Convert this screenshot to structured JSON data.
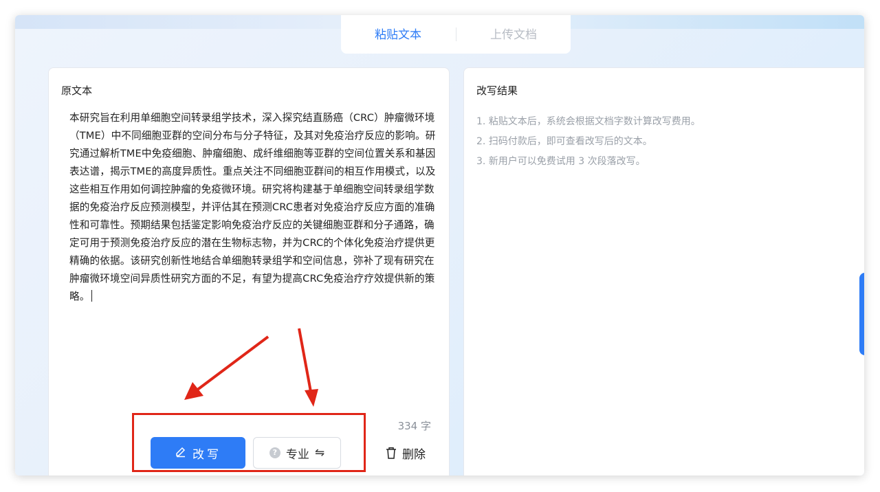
{
  "tabs": {
    "paste": "粘贴文本",
    "upload": "上传文档"
  },
  "source_panel": {
    "title": "原文本",
    "text": "本研究旨在利用单细胞空间转录组学技术，深入探究结直肠癌（CRC）肿瘤微环境（TME）中不同细胞亚群的空间分布与分子特征，及其对免疫治疗反应的影响。研究通过解析TME中免疫细胞、肿瘤细胞、成纤维细胞等亚群的空间位置关系和基因表达谱，揭示TME的高度异质性。重点关注不同细胞亚群间的相互作用模式，以及这些相互作用如何调控肿瘤的免疫微环境。研究将构建基于单细胞空间转录组学数据的免疫治疗反应预测模型，并评估其在预测CRC患者对免疫治疗反应方面的准确性和可靠性。预期结果包括鉴定影响免疫治疗反应的关键细胞亚群和分子通路，确定可用于预测免疫治疗反应的潜在生物标志物，并为CRC的个体化免疫治疗提供更精确的依据。该研究创新性地结合单细胞转录组学和空间信息，弥补了现有研究在肿瘤微环境空间异质性研究方面的不足，有望为提高CRC免疫治疗疗效提供新的策略。",
    "word_count": "334 字",
    "rewrite_label": "改写",
    "mode_label": "专业",
    "mode_switch_glyph": "⇋",
    "delete_label": "删除"
  },
  "result_panel": {
    "title": "改写结果",
    "tips": [
      "1. 粘贴文本后，系统会根据文档字数计算改写费用。",
      "2. 扫码付款后，即可查看改写后的文本。",
      "3. 新用户可以免费试用 3 次段落改写。"
    ]
  },
  "colors": {
    "accent": "#2e7cf6",
    "annotation": "#e02618"
  }
}
